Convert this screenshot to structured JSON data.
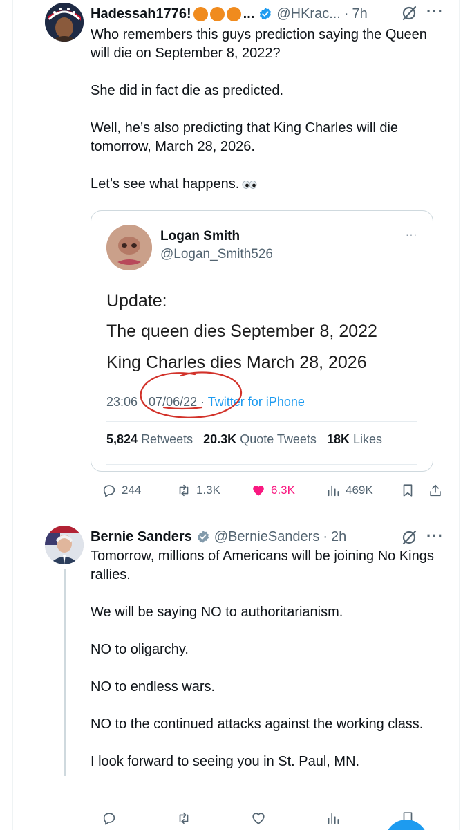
{
  "tweet1": {
    "display_name": "Hadessah1776!",
    "name_emoji": [
      "orange",
      "orange",
      "orange"
    ],
    "name_ellipsis": "...",
    "handle": "@HKrac...",
    "separator": "·",
    "time": "7h",
    "more_icon": "more-dots-icon",
    "text": [
      "Who remembers this guys prediction saying the Queen will die on September 8, 2022?",
      "She did in fact die as predicted.",
      "Well, he’s also predicting that King Charles will die tomorrow, March 28, 2026.",
      "Let’s see what happens."
    ],
    "quoted": {
      "name": "Logan Smith",
      "handle": "@Logan_Smith526",
      "more": "···",
      "update": "Update:",
      "line1": "The queen dies September 8, 2022",
      "line2": "King Charles dies March 28, 2026",
      "time": "23:06",
      "date": "07/06/22",
      "source": "Twitter for iPhone",
      "retweets_value": "5,824",
      "retweets_label": "Retweets",
      "quotes_value": "20.3K",
      "quotes_label": "Quote Tweets",
      "likes_value": "18K",
      "likes_label": "Likes"
    },
    "actions": {
      "replies": "244",
      "retweets": "1.3K",
      "likes": "6.3K",
      "views": "469K"
    }
  },
  "tweet2": {
    "display_name": "Bernie Sanders",
    "handle": "@BernieSanders",
    "separator": "·",
    "time": "2h",
    "text": [
      "Tomorrow, millions of Americans will be joining No Kings rallies.",
      "We will be saying NO to authoritarianism.",
      "NO to oligarchy.",
      "NO to endless wars.",
      "NO to the continued attacks against the working class.",
      "I look forward to seeing you in St. Paul, MN."
    ]
  },
  "colors": {
    "text": "#0f1419",
    "secondary": "#536471",
    "like": "#f91880",
    "accent": "#1d9bf0",
    "annotation_circle": "#d2322a"
  }
}
